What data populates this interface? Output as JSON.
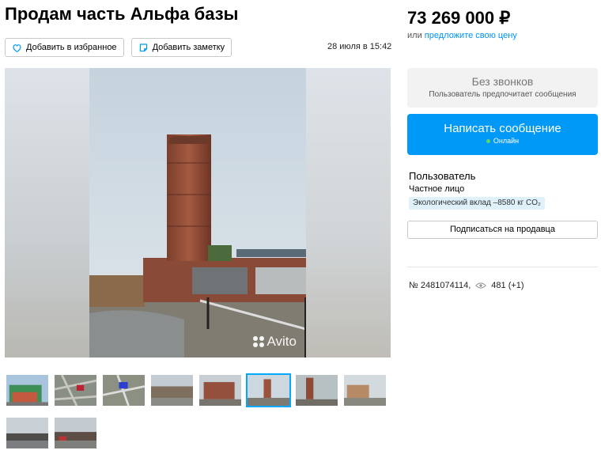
{
  "title": "Продам часть Альфа базы",
  "actions": {
    "favorite_label": "Добавить в избранное",
    "note_label": "Добавить заметку"
  },
  "date": "28 июля в 15:42",
  "price": {
    "value": "73 269 000 ₽",
    "sub_prefix": "или",
    "sub_link": "предложите свою цену"
  },
  "contact": {
    "nocalls_title": "Без звонков",
    "nocalls_sub": "Пользователь предпочитает сообщения",
    "write_label": "Написать сообщение",
    "online_label": "Онлайн"
  },
  "seller": {
    "name": "Пользователь",
    "type": "Частное лицо",
    "eco": "Экологический вклад –8580 кг CO₂",
    "subscribe_label": "Подписаться на продавца"
  },
  "meta": {
    "id": "№ 2481074114,",
    "views": "481 (+1)"
  },
  "gallery": {
    "watermark": "Avito",
    "active_thumb": 6,
    "thumbs": [
      "photo-1",
      "photo-2",
      "photo-3",
      "photo-4",
      "photo-5",
      "photo-6",
      "photo-7",
      "photo-8",
      "photo-9",
      "photo-10"
    ]
  },
  "colors": {
    "accent": "#0099f7",
    "link": "#0091ff",
    "online": "#5ed85e",
    "eco_bg": "#dff1fb"
  }
}
